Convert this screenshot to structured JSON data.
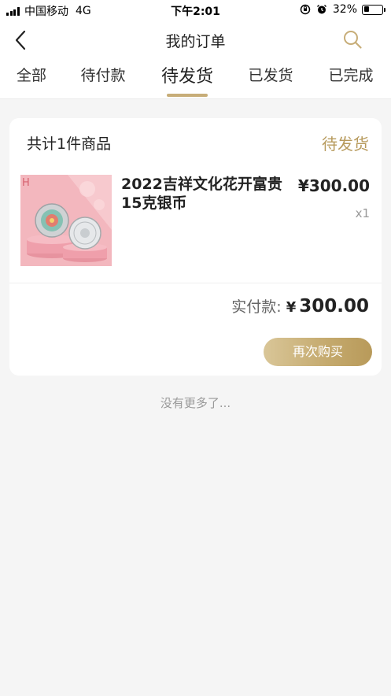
{
  "status_bar": {
    "carrier": "中国移动",
    "network": "4G",
    "time": "下午2:01",
    "battery": "32%",
    "battery_level": 0.32,
    "icons": [
      "signal-icon",
      "orientation-lock-icon",
      "alarm-icon",
      "battery-icon"
    ]
  },
  "nav": {
    "title": "我的订单",
    "back_icon": "back-icon",
    "search_icon": "search-icon"
  },
  "tabs": [
    {
      "label": "全部",
      "active": false
    },
    {
      "label": "待付款",
      "active": false
    },
    {
      "label": "待发货",
      "active": true
    },
    {
      "label": "已发货",
      "active": false
    },
    {
      "label": "已完成",
      "active": false
    }
  ],
  "order": {
    "count_text": "共计1件商品",
    "status": "待发货",
    "product": {
      "name": "2022吉祥文化花开富贵15克银币",
      "price": "¥300.00",
      "quantity": "x1"
    },
    "paid_label": "实付款:",
    "paid_currency": "¥",
    "paid_amount": "300.00",
    "rebuy_label": "再次购买"
  },
  "footer_text": "没有更多了...",
  "colors": {
    "accent": "#c7ad78",
    "status_text": "#b79a5c",
    "background": "#f5f5f5"
  }
}
